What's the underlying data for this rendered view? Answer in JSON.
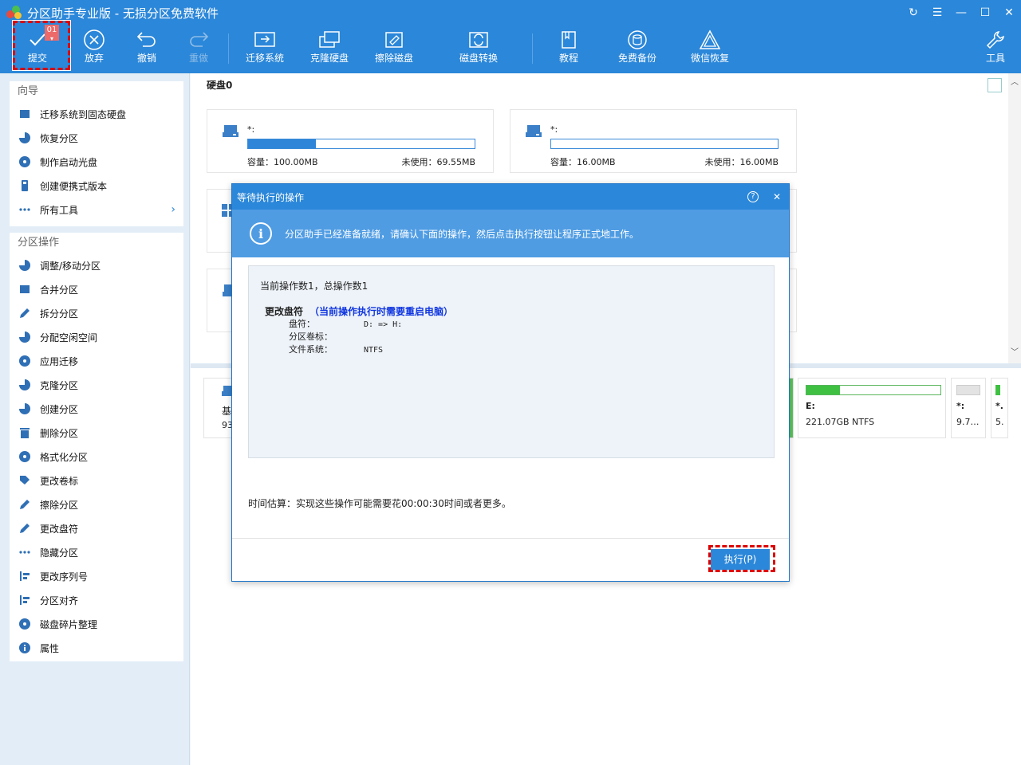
{
  "app": {
    "title": "分区助手专业版 - 无损分区免费软件",
    "window_controls": [
      "↻",
      "☰",
      "—",
      "☐",
      "✕"
    ]
  },
  "toolbar": {
    "commit_label": "提交",
    "commit_badge": "01",
    "discard_label": "放弃",
    "undo_label": "撤销",
    "redo_label": "重做",
    "migrate_label": "迁移系统",
    "clone_label": "克隆硬盘",
    "wipe_label": "擦除磁盘",
    "convert_label": "磁盘转换",
    "tutorial_label": "教程",
    "backup_label": "免费备份",
    "wechat_label": "微信恢复",
    "tools_label": "工具"
  },
  "sidebar": {
    "wizard_title": "向导",
    "wizard_items": [
      {
        "label": "迁移系统到固态硬盘",
        "icon": "migrate-ssd-icon"
      },
      {
        "label": "恢复分区",
        "icon": "recover-partition-icon"
      },
      {
        "label": "制作启动光盘",
        "icon": "bootable-media-icon"
      },
      {
        "label": "创建便携式版本",
        "icon": "portable-icon"
      },
      {
        "label": "所有工具",
        "icon": "all-tools-icon"
      }
    ],
    "ops_title": "分区操作",
    "ops_items": [
      {
        "label": "调整/移动分区"
      },
      {
        "label": "合并分区"
      },
      {
        "label": "拆分分区"
      },
      {
        "label": "分配空闲空间"
      },
      {
        "label": "应用迁移"
      },
      {
        "label": "克隆分区"
      },
      {
        "label": "创建分区"
      },
      {
        "label": "删除分区"
      },
      {
        "label": "格式化分区"
      },
      {
        "label": "更改卷标"
      },
      {
        "label": "擦除分区"
      },
      {
        "label": "更改盘符"
      },
      {
        "label": "隐藏分区"
      },
      {
        "label": "更改序列号"
      },
      {
        "label": "分区对齐"
      },
      {
        "label": "磁盘碎片整理"
      },
      {
        "label": "属性"
      }
    ]
  },
  "main": {
    "disk_label": "硬盘0",
    "cards": [
      {
        "name": "*:",
        "capacity": "容量：100.00MB",
        "free": "未使用：69.55MB",
        "used_fraction": 0.3
      },
      {
        "name": "*:",
        "capacity": "容量：16.00MB",
        "free": "未使用：16.00MB",
        "used_fraction": 0.0
      }
    ],
    "lower": {
      "left_initial": "基",
      "left_num": "93",
      "e_name": "E:",
      "e_info": "221.07GB NTFS",
      "e_used_fraction": 0.25,
      "small1_name": "*:",
      "small1_info": "9.7…",
      "small2_name": "*.",
      "small2_info": "5."
    }
  },
  "dialog": {
    "title": "等待执行的操作",
    "help": "?",
    "close": "✕",
    "info_icon": "i",
    "banner": "分区助手已经准备就绪，请确认下面的操作，然后点击执行按钮让程序正式地工作。",
    "op_count": "当前操作数1，总操作数1",
    "op_title": "更改盘符",
    "op_warning": "（当前操作执行时需要重启电脑）",
    "rows": [
      {
        "k": "盘符：",
        "v": "D: => H:"
      },
      {
        "k": "分区卷标：",
        "v": ""
      },
      {
        "k": "文件系统：",
        "v": "NTFS"
      }
    ],
    "time_estimate": "时间估算：实现这些操作可能需要花00:00:30时间或者更多。",
    "execute_label": "执行(P)"
  }
}
